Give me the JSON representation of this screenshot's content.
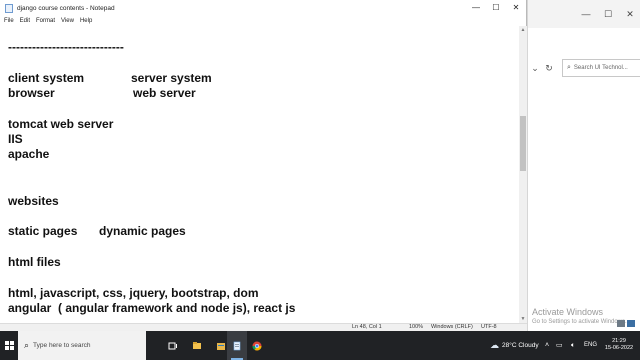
{
  "notepad": {
    "title": "django course contents - Notepad",
    "window_controls": {
      "minimize": "—",
      "maximize": "☐",
      "close": "✕"
    },
    "menu": [
      "File",
      "Edit",
      "Format",
      "View",
      "Help"
    ],
    "lines": [
      {
        "a": "-----------------------------",
        "b": ""
      },
      {
        "a": "",
        "b": ""
      },
      {
        "a": "client system",
        "b": "server system"
      },
      {
        "a": "browser",
        "b": "web server"
      },
      {
        "a": "",
        "b": ""
      },
      {
        "a": "tomcat web server",
        "b": ""
      },
      {
        "a": "IIS",
        "b": ""
      },
      {
        "a": "apache",
        "b": ""
      },
      {
        "a": "",
        "b": ""
      },
      {
        "a": "",
        "b": ""
      },
      {
        "a": "websites",
        "b": ""
      },
      {
        "a": "",
        "b": ""
      },
      {
        "a": "static pages",
        "b": "dynamic pages"
      },
      {
        "a": "",
        "b": ""
      },
      {
        "a": "html files",
        "b": ""
      },
      {
        "a": "",
        "b": ""
      },
      {
        "a": "html, javascript, css, jquery, bootstrap, dom",
        "b": ""
      },
      {
        "a": "angular  ( angular framework and node js), react js",
        "b": ""
      }
    ],
    "status": {
      "position": "Ln 48, Col 1",
      "zoom": "100%",
      "line_ending": "Windows (CRLF)",
      "encoding": "UTF-8"
    }
  },
  "background_window": {
    "controls": {
      "minimize": "—",
      "maximize": "☐",
      "close": "✕"
    },
    "search_placeholder": "Search UI Technol...",
    "watermark_title": "Activate Windows",
    "watermark_subtitle": "Go to Settings to activate Windows."
  },
  "taskbar": {
    "search_placeholder": "Type here to search",
    "apps": [
      "task-view",
      "file-explorer",
      "notepad-app",
      "chrome"
    ],
    "weather": "28°C  Cloudy",
    "language": "ENG",
    "time": "21:29",
    "date": "15-06-2022"
  },
  "colors": {
    "taskbar_bg": "#202225",
    "editor_text": "#111111",
    "watermark": "#9a9a9a"
  }
}
